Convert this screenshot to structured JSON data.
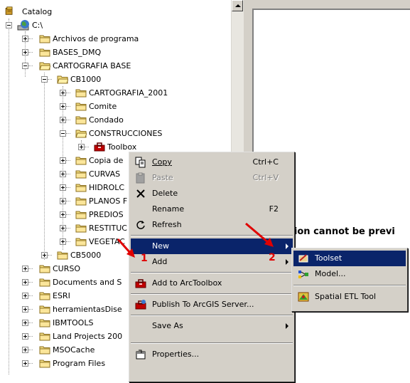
{
  "tree": {
    "root_label": "Catalog",
    "drive_label": "C:\\",
    "items": [
      "Archivos de programa",
      "BASES_DMQ",
      "CARTOGRAFIA BASE",
      "CB1000",
      "CARTOGRAFIA_2001",
      "Comite",
      "Condado",
      "CONSTRUCCIONES",
      "Toolbox",
      "Copia de",
      "CURVAS",
      "HIDROLC",
      "PLANOS F",
      "PREDIOS",
      "RESTITUC",
      "VEGETAC",
      "CB5000",
      "CURSO",
      "Documents and S",
      "ESRI",
      "herramientasDise",
      "IBMTOOLS",
      "Land Projects 200",
      "MSOCache",
      "Program Files"
    ]
  },
  "preview_message": "ction cannot be previ",
  "context_menu": {
    "copy": {
      "label": "Copy",
      "shortcut": "Ctrl+C"
    },
    "paste": {
      "label": "Paste",
      "shortcut": "Ctrl+V"
    },
    "delete": {
      "label": "Delete"
    },
    "rename": {
      "label": "Rename",
      "shortcut": "F2"
    },
    "refresh": {
      "label": "Refresh"
    },
    "new": {
      "label": "New"
    },
    "add": {
      "label": "Add"
    },
    "add_to_arctoolbox": {
      "label": "Add to ArcToolbox"
    },
    "publish": {
      "label": "Publish To ArcGIS Server..."
    },
    "save_as": {
      "label": "Save As"
    },
    "properties": {
      "label": "Properties..."
    }
  },
  "submenu": {
    "toolset": {
      "label": "Toolset"
    },
    "model": {
      "label": "Model..."
    },
    "spatial_etl": {
      "label": "Spatial ETL Tool"
    }
  },
  "annotations": {
    "badge1": "1",
    "badge2": "2",
    "color": "#e00000"
  }
}
